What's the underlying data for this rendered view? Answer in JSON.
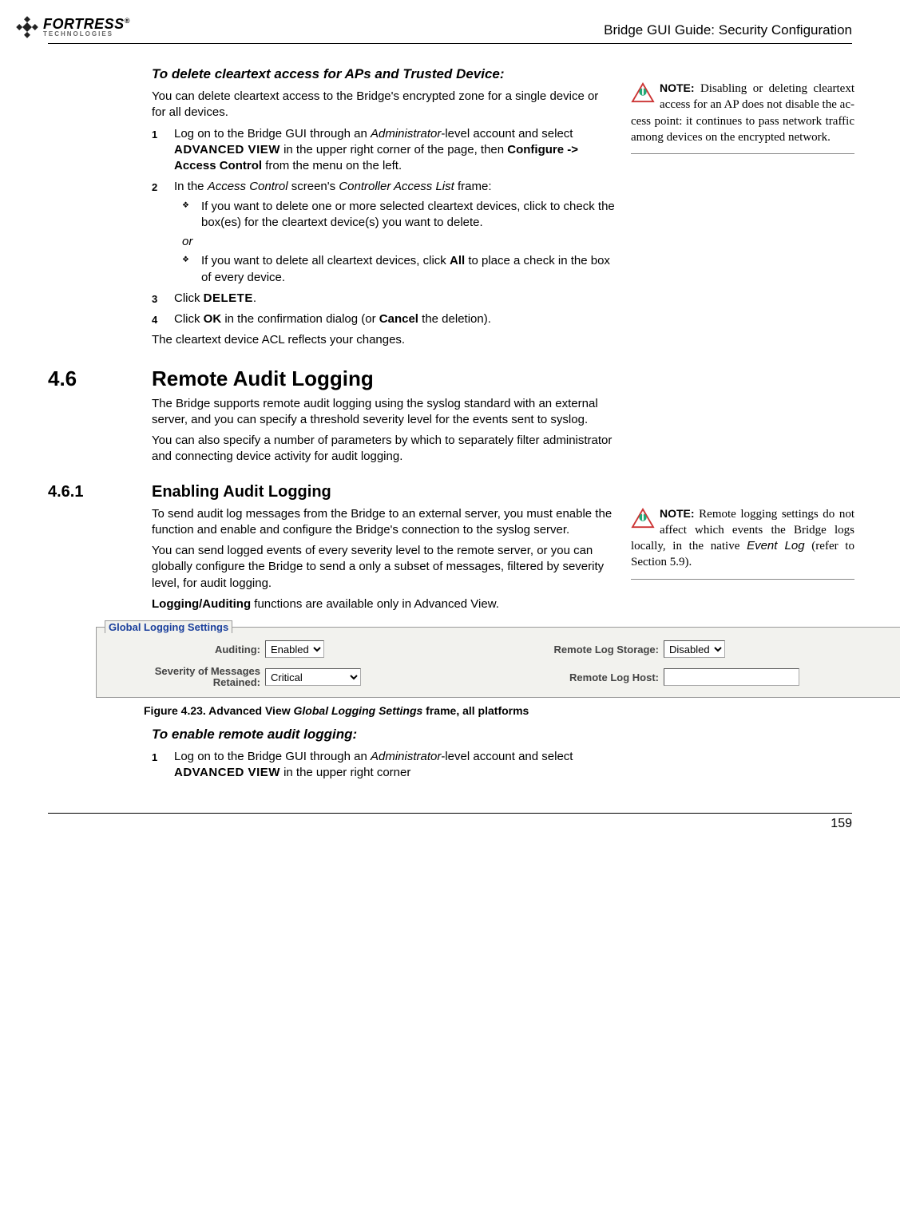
{
  "header": {
    "brand_top": "FORTRESS",
    "brand_bottom": "TECHNOLOGIES",
    "brand_reg": "®",
    "doc_title": "Bridge GUI Guide: Security Configuration"
  },
  "proc1": {
    "heading": "To delete cleartext access for APs and Trusted Device:",
    "intro": "You can delete cleartext access to the Bridge's encrypted zone for a single device or for all devices.",
    "step1_a": "Log on to the Bridge GUI through an ",
    "step1_b": "Administrator",
    "step1_c": "-level account and select ",
    "step1_d": "ADVANCED VIEW",
    "step1_e": " in the upper right corner of the page, then ",
    "step1_f": "Configure -> Access Control",
    "step1_g": " from the menu on the left.",
    "step2_a": "In the ",
    "step2_b": "Access Control",
    "step2_c": " screen's ",
    "step2_d": "Controller Access List",
    "step2_e": " frame:",
    "sub1": "If you want to delete one or more selected cleartext devices, click to check the box(es) for the cleartext device(s) you want to delete.",
    "or": "or",
    "sub2_a": "If you want to delete all cleartext devices, click ",
    "sub2_b": "All",
    "sub2_c": " to place a check in the box of every device.",
    "step3_a": "Click ",
    "step3_b": "DELETE",
    "step3_c": ".",
    "step4_a": "Click ",
    "step4_b": "OK",
    "step4_c": " in the confirmation dialog (or ",
    "step4_d": "Cancel",
    "step4_e": " the deletion).",
    "outro": "The cleartext device ACL reflects your changes."
  },
  "note1": {
    "label": "NOTE:",
    "text": " Disabling or deleting cleart­ext access for an AP does not disable the ac­cess point: it continues to pass network traffic among devices on the encrypted network."
  },
  "sec46": {
    "num": "4.6",
    "title": "Remote Audit Logging",
    "p1": "The Bridge supports remote audit logging using the syslog standard with an external server, and you can specify a threshold severity level for the events sent to syslog.",
    "p2": "You can also specify a number of parameters by which to separately filter administrator and connecting device activity for audit logging."
  },
  "sec461": {
    "num": "4.6.1",
    "title": "Enabling Audit Logging",
    "p1": "To send audit log messages from the Bridge to an external server, you must enable the function and enable and configure the Bridge's connection to the syslog server.",
    "p2": "You can send logged events of every severity level to the remote server, or you can globally configure the Bridge to send a only a subset of messages, filtered by severity level, for audit logging.",
    "p3_a": "Logging/Auditing",
    "p3_b": " functions are available only in Advanced View."
  },
  "note2": {
    "label": "NOTE:",
    "text_a": " Remote log­ging settings do not affect which events the Bridge logs locally, in the native ",
    "text_b": "Event Log",
    "text_c": " (refer to Section 5.9)."
  },
  "screenshot": {
    "panel_title": "Global Logging Settings",
    "auditing_label": "Auditing:",
    "auditing_value": "Enabled",
    "severity_label_1": "Severity of Messages",
    "severity_label_2": "Retained:",
    "severity_value": "Critical",
    "remote_storage_label": "Remote Log Storage:",
    "remote_storage_value": "Disabled",
    "remote_host_label": "Remote Log Host:",
    "remote_host_value": ""
  },
  "fig": {
    "label": "Figure 4.23. Advanced View ",
    "em": "Global Logging Settings",
    "tail": " frame, all platforms"
  },
  "proc2": {
    "heading": "To enable remote audit logging:",
    "step1_a": "Log on to the Bridge GUI through an ",
    "step1_b": "Administrator",
    "step1_c": "-level account and select ",
    "step1_d": "ADVANCED VIEW",
    "step1_e": " in the upper right corner"
  },
  "footer": {
    "page": "159"
  },
  "chart_data": {
    "type": "table",
    "title": "Global Logging Settings",
    "rows": [
      {
        "field": "Auditing",
        "value": "Enabled"
      },
      {
        "field": "Severity of Messages Retained",
        "value": "Critical"
      },
      {
        "field": "Remote Log Storage",
        "value": "Disabled"
      },
      {
        "field": "Remote Log Host",
        "value": ""
      }
    ]
  }
}
